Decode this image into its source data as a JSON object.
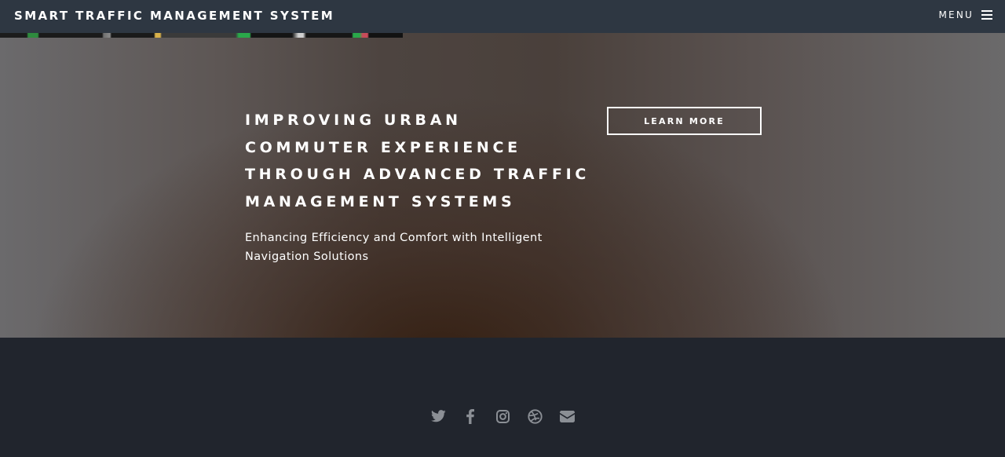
{
  "navbar": {
    "brand": "Smart Traffic Management System",
    "menu_label": "Menu",
    "menu_icon": "hamburger-icon"
  },
  "hero": {
    "heading": "Improving Urban Commuter Experience through Advanced Traffic Management Systems",
    "subtitle": "Enhancing Efficiency and Comfort with Intelligent Navigation Solutions",
    "cta_label": "Learn More"
  },
  "footer": {
    "social_links": [
      {
        "icon": "twitter-icon"
      },
      {
        "icon": "facebook-icon"
      },
      {
        "icon": "instagram-icon"
      },
      {
        "icon": "dribbble-icon"
      },
      {
        "icon": "envelope-icon"
      }
    ]
  },
  "colors": {
    "navbar_bg": "#2e3742",
    "footer_bg": "#21252d",
    "icon_gray": "#8b8f95",
    "text_white": "#ffffff"
  }
}
